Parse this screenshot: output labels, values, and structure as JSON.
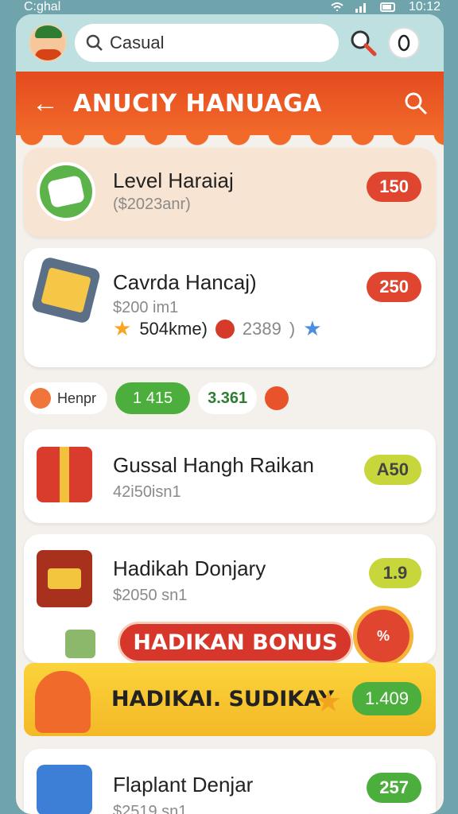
{
  "status_bar": {
    "left": "C:ghal",
    "time": "10:12"
  },
  "search": {
    "value": "Casual"
  },
  "header": {
    "title": "ANUCIY HANUAGA"
  },
  "cards": [
    {
      "title": "Level Haraiaj",
      "sub": "($2023anr)",
      "badge": "150"
    },
    {
      "title": "Cavrda Hancaj)",
      "sub": "$200 im1",
      "badge": "250",
      "stats": {
        "a": "504kme)",
        "b": "2389",
        "c": ")"
      }
    },
    {
      "title": "Gussal Hangh Raikan",
      "sub": "42i50isn1",
      "badge": "A50"
    },
    {
      "title": "Hadikah Donjary",
      "sub": "$2050 sn1",
      "badge": "1.9"
    },
    {
      "title": "Flaplant Denjar",
      "sub": "$2519 sn1",
      "badge": "257"
    }
  ],
  "mini": {
    "tag": "Henpr",
    "green": "1 415",
    "white": "3.361"
  },
  "bonus": {
    "button": "HADIKAN BONUS",
    "badge": "%"
  },
  "banner": {
    "text": "HADIKAI. SUDIKAY",
    "value": "1.409"
  },
  "colors": {
    "accent": "#e44a1f",
    "green": "#4caf3d",
    "lime": "#c6d63b",
    "yellow": "#fbd33a"
  }
}
